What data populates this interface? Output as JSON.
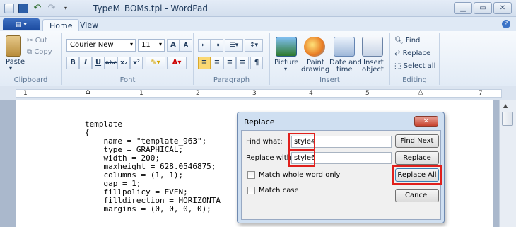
{
  "window": {
    "title": "TypeM_BOMs.tpl - WordPad",
    "controls": [
      "minimize",
      "maximize",
      "close"
    ]
  },
  "ribbon": {
    "tabs": [
      "Home",
      "View"
    ],
    "clipboard": {
      "paste": "Paste",
      "cut": "Cut",
      "copy": "Copy",
      "label": "Clipboard"
    },
    "font": {
      "family": "Courier New",
      "size": "11",
      "label": "Font"
    },
    "paragraph": {
      "label": "Paragraph"
    },
    "insert": {
      "picture": "Picture",
      "paint_1": "Paint",
      "paint_2": "drawing",
      "date_1": "Date and",
      "date_2": "time",
      "object_1": "Insert",
      "object_2": "object",
      "label": "Insert"
    },
    "editing": {
      "find": "Find",
      "replace": "Replace",
      "select_all": "Select all",
      "label": "Editing"
    }
  },
  "ruler": {
    "numbers": [
      "1",
      "1",
      "2",
      "3",
      "4",
      "5",
      "6",
      "7"
    ]
  },
  "document": {
    "lines": [
      "template",
      "{",
      "    name = \"template_963\";",
      "    type = GRAPHICAL;",
      "    width = 200;",
      "    maxheight = 628.0546875;",
      "    columns = (1, 1);",
      "    gap = 1;",
      "    fillpolicy = EVEN;",
      "    filldirection = HORIZONTA",
      "    margins = (0, 0, 0, 0);"
    ]
  },
  "dialog": {
    "title": "Replace",
    "find_label": "Find what:",
    "find_value": "style4",
    "replace_label": "Replace with:",
    "replace_value": "style6",
    "find_next": "Find Next",
    "replace": "Replace",
    "replace_all": "Replace All",
    "cancel": "Cancel",
    "match_word": "Match whole word only",
    "match_case": "Match case"
  }
}
